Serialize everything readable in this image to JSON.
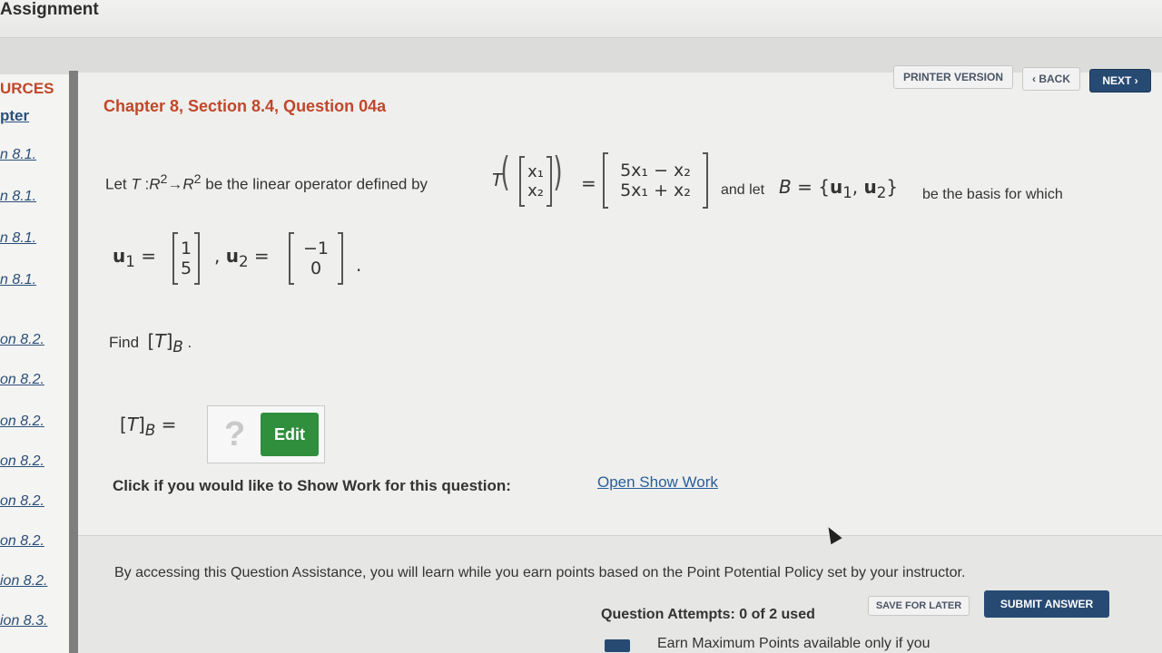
{
  "app": {
    "title": "Assignment"
  },
  "sidebar": {
    "heading": "URCES",
    "chapter": "pter",
    "items": [
      {
        "label": "n 8.1."
      },
      {
        "label": "n 8.1."
      },
      {
        "label": "n 8.1."
      },
      {
        "label": "n 8.1."
      },
      {
        "label": "on 8.2."
      },
      {
        "label": "on 8.2."
      },
      {
        "label": "on 8.2."
      },
      {
        "label": "on 8.2."
      },
      {
        "label": "on 8.2."
      },
      {
        "label": "on 8.2."
      },
      {
        "label": "ion 8.2."
      },
      {
        "label": "ion 8.3."
      }
    ]
  },
  "toolbar": {
    "printer_label": "PRINTER VERSION",
    "back_label": "‹ BACK",
    "next_label": "NEXT ›"
  },
  "question": {
    "title": "Chapter 8, Section 8.4, Question 04a",
    "intro": "be the linear operator defined by",
    "and_let": "and let",
    "basis_tail": "be the basis for which",
    "find": "Find",
    "matrix_in": [
      "x₁",
      "x₂"
    ],
    "matrix_out": [
      "5x₁ − x₂",
      "5x₁ + x₂"
    ],
    "u1": [
      "1",
      "5"
    ],
    "u2": [
      "−1",
      "0"
    ]
  },
  "answer": {
    "placeholder": "?",
    "edit_label": "Edit"
  },
  "show_work": {
    "label": "Click if you would like to Show Work for this question:",
    "link": "Open Show Work"
  },
  "assistance": {
    "text": "By accessing this Question Assistance, you will learn while you earn points based on the Point Potential Policy set by your instructor.",
    "attempts": "Question Attempts: 0 of 2 used",
    "save_later": "SAVE FOR LATER",
    "submit": "SUBMIT ANSWER",
    "earn": "Earn Maximum Points available only if you"
  }
}
